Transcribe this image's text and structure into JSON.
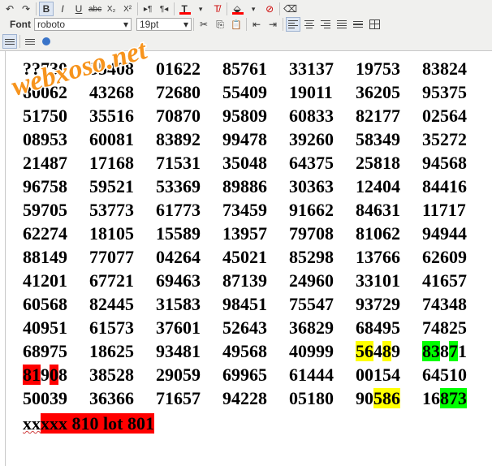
{
  "toolbar": {
    "row1": {
      "undo": "↶",
      "redo": "↷",
      "bold": "B",
      "italic": "I",
      "underline": "U",
      "strike": "abc",
      "subscript": "X₂",
      "superscript": "X²",
      "ltr": "▸¶",
      "rtl": "¶◂",
      "forecolor": "T",
      "clearcolor": "T̸",
      "backcolor": "⬙",
      "clearback": "⊘",
      "eraser": "⌫"
    },
    "row2": {
      "font_label": "Font",
      "font_value": "roboto",
      "size_value": "19pt",
      "cut": "✂",
      "copy": "⎘",
      "paste": "📋",
      "outdent": "⇤",
      "indent": "⇥"
    },
    "colors": {
      "forecolor": "#ff0000",
      "backcolor": "#ff0000"
    }
  },
  "watermark": {
    "text": "webxoso.net"
  },
  "rows": [
    [
      {
        "t": "??730",
        "p": []
      },
      {
        "t": "35408"
      },
      {
        "t": "01622"
      },
      {
        "t": "85761"
      },
      {
        "t": "33137"
      },
      {
        "t": "19753"
      },
      {
        "t": "83824"
      }
    ],
    [
      {
        "t": "80062"
      },
      {
        "t": "43268"
      },
      {
        "t": "72680"
      },
      {
        "t": "55409"
      },
      {
        "t": "19011"
      },
      {
        "t": "36205"
      },
      {
        "t": "95375"
      }
    ],
    [
      {
        "t": "51750"
      },
      {
        "t": "35516"
      },
      {
        "t": "70870"
      },
      {
        "t": "95809"
      },
      {
        "t": "60833"
      },
      {
        "t": "82177"
      },
      {
        "t": "02564"
      }
    ],
    [
      {
        "t": "08953"
      },
      {
        "t": "60081"
      },
      {
        "t": "83892"
      },
      {
        "t": "99478"
      },
      {
        "t": "39260"
      },
      {
        "t": "58349"
      },
      {
        "t": "35272"
      }
    ],
    [
      {
        "t": "21487"
      },
      {
        "t": "17168"
      },
      {
        "t": "71531"
      },
      {
        "t": "35048"
      },
      {
        "t": "64375"
      },
      {
        "t": "25818"
      },
      {
        "t": "94568"
      }
    ],
    [
      {
        "t": "96758"
      },
      {
        "t": "59521"
      },
      {
        "t": "53369"
      },
      {
        "t": "89886"
      },
      {
        "t": "30363"
      },
      {
        "t": "12404"
      },
      {
        "t": "84416"
      }
    ],
    [
      {
        "t": "59705"
      },
      {
        "t": "53773"
      },
      {
        "t": "61773"
      },
      {
        "t": "73459"
      },
      {
        "t": "91662"
      },
      {
        "t": "84631"
      },
      {
        "t": "11717"
      }
    ],
    [
      {
        "t": "62274"
      },
      {
        "t": "18105"
      },
      {
        "t": "15589"
      },
      {
        "t": "13957"
      },
      {
        "t": "79708"
      },
      {
        "t": "81062"
      },
      {
        "t": "94944"
      }
    ],
    [
      {
        "t": "88149"
      },
      {
        "t": "77077"
      },
      {
        "t": "04264"
      },
      {
        "t": "45021"
      },
      {
        "t": "85298"
      },
      {
        "t": "13766"
      },
      {
        "t": "62609"
      }
    ],
    [
      {
        "t": "41201"
      },
      {
        "t": "67721"
      },
      {
        "t": "69463"
      },
      {
        "t": "87139"
      },
      {
        "t": "24960"
      },
      {
        "t": "33101"
      },
      {
        "t": "41657"
      }
    ],
    [
      {
        "t": "60568"
      },
      {
        "t": "82445"
      },
      {
        "t": "31583"
      },
      {
        "t": "98451"
      },
      {
        "t": "75547"
      },
      {
        "t": "93729"
      },
      {
        "t": "74348"
      }
    ],
    [
      {
        "t": "40951"
      },
      {
        "t": "61573"
      },
      {
        "t": "37601"
      },
      {
        "t": "52643"
      },
      {
        "t": "36829"
      },
      {
        "t": "68495"
      },
      {
        "t": "74825"
      }
    ],
    [
      {
        "t": "68975"
      },
      {
        "t": "18625"
      },
      {
        "t": "93481"
      },
      {
        "t": "49568"
      },
      {
        "t": "40999"
      },
      {
        "parts": [
          {
            "t": "56",
            "c": "y"
          },
          {
            "t": "4"
          },
          {
            "t": "8",
            "c": "y"
          },
          {
            "t": "9"
          }
        ]
      },
      {
        "parts": [
          {
            "t": "83",
            "c": "g"
          },
          {
            "t": "8"
          },
          {
            "t": "7",
            "c": "g"
          },
          {
            "t": "1"
          }
        ]
      }
    ],
    [
      {
        "parts": [
          {
            "t": "81",
            "c": "r"
          },
          {
            "t": "9"
          },
          {
            "t": "0",
            "c": "r"
          },
          {
            "t": "8"
          }
        ]
      },
      {
        "t": "38528"
      },
      {
        "t": "29059"
      },
      {
        "t": "69965"
      },
      {
        "t": "61444"
      },
      {
        "t": "00154"
      },
      {
        "t": "64510"
      }
    ],
    [
      {
        "t": "50039"
      },
      {
        "t": "36366"
      },
      {
        "t": "71657"
      },
      {
        "t": "94228"
      },
      {
        "t": "05180"
      },
      {
        "parts": [
          {
            "t": "90"
          },
          {
            "t": "586",
            "c": "y"
          }
        ]
      },
      {
        "parts": [
          {
            "t": "16"
          },
          {
            "t": "873",
            "c": "g"
          }
        ]
      }
    ]
  ],
  "footer": {
    "plain": "xx",
    "red": "xxx 810 lot 801"
  }
}
